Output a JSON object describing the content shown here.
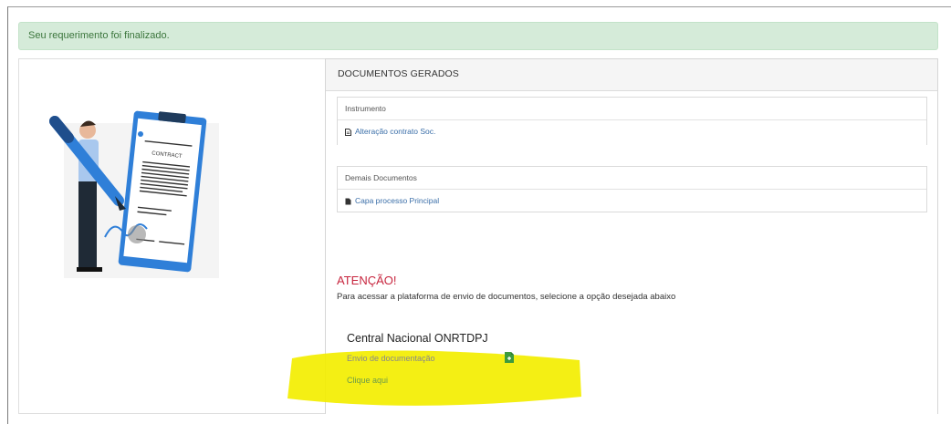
{
  "alert": {
    "message": "Seu requerimento foi finalizado."
  },
  "illustration": {
    "contract_label": "CONTRACT"
  },
  "panel": {
    "title": "DOCUMENTOS GERADOS",
    "sections": [
      {
        "header": "Instrumento",
        "link": "Alteração contrato Soc."
      },
      {
        "header": "Demais Documentos",
        "link": "Capa processo Principal"
      }
    ]
  },
  "attention": {
    "title": "ATENÇÃO!",
    "text": "Para acessar a plataforma de envio de documentos, selecione a opção desejada abaixo"
  },
  "platform_card": {
    "title": "Central Nacional ONRTDPJ",
    "subtitle": "Envio de documentação",
    "link": "Clique aqui",
    "icon": "green-document-icon"
  },
  "colors": {
    "alert_bg": "#d5ebd9",
    "attention_red": "#c7253e",
    "link_blue": "#3a6ea8",
    "highlight_yellow": "#f3ee00"
  }
}
